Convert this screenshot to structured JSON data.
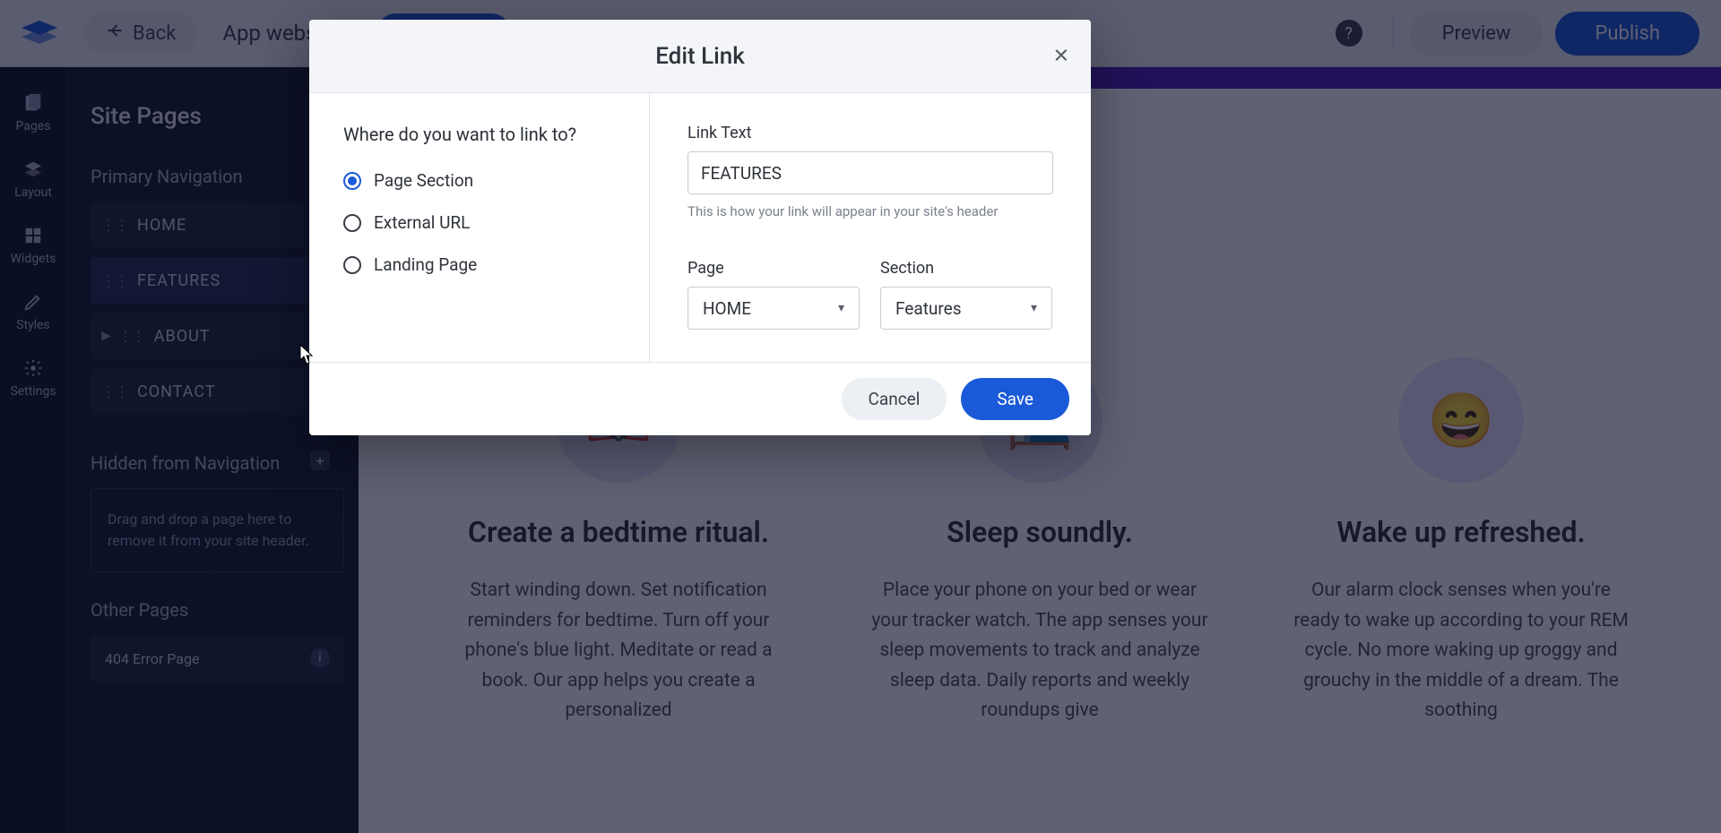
{
  "topbar": {
    "back": "Back",
    "app_name": "App website",
    "preview": "Preview",
    "publish": "Publish"
  },
  "rail": {
    "items": [
      {
        "key": "pages",
        "label": "Pages"
      },
      {
        "key": "layout",
        "label": "Layout"
      },
      {
        "key": "widgets",
        "label": "Widgets"
      },
      {
        "key": "styles",
        "label": "Styles"
      },
      {
        "key": "settings",
        "label": "Settings"
      }
    ]
  },
  "sidebar": {
    "title": "Site Pages",
    "primary_label": "Primary Navigation",
    "hidden_label": "Hidden from Navigation",
    "other_label": "Other Pages",
    "nav": [
      {
        "label": "HOME",
        "kind": "home"
      },
      {
        "label": "FEATURES",
        "kind": "link",
        "selected": true
      },
      {
        "label": "ABOUT",
        "kind": "folder"
      },
      {
        "label": "CONTACT",
        "kind": "page"
      }
    ],
    "dropzone_text": "Drag and drop a page here to remove it from your site header.",
    "error_page": "404 Error Page"
  },
  "features": [
    {
      "emoji": "📖",
      "title": "Create a bedtime ritual.",
      "body": "Start winding down. Set notification reminders for bedtime. Turn off your phone's blue light. Meditate or read a book. Our app helps you create a personalized"
    },
    {
      "emoji": "🛏️",
      "title": "Sleep soundly.",
      "body": "Place your phone on your bed or wear your tracker watch. The app senses your sleep movements to track and analyze sleep data. Daily reports and weekly roundups give"
    },
    {
      "emoji": "😄",
      "title": "Wake up refreshed.",
      "body": "Our alarm clock senses when you're ready to wake up according to your REM cycle. No more waking up groggy and grouchy in the middle of a dream. The soothing"
    }
  ],
  "modal": {
    "title": "Edit Link",
    "question": "Where do you want to link to?",
    "options": [
      {
        "key": "page_section",
        "label": "Page Section",
        "selected": true
      },
      {
        "key": "external_url",
        "label": "External URL",
        "selected": false
      },
      {
        "key": "landing_page",
        "label": "Landing Page",
        "selected": false
      }
    ],
    "link_text_label": "Link Text",
    "link_text_value": "FEATURES",
    "link_text_hint": "This is how your link will appear in your site's header",
    "page_label": "Page",
    "page_value": "HOME",
    "section_label": "Section",
    "section_value": "Features",
    "cancel": "Cancel",
    "save": "Save"
  }
}
